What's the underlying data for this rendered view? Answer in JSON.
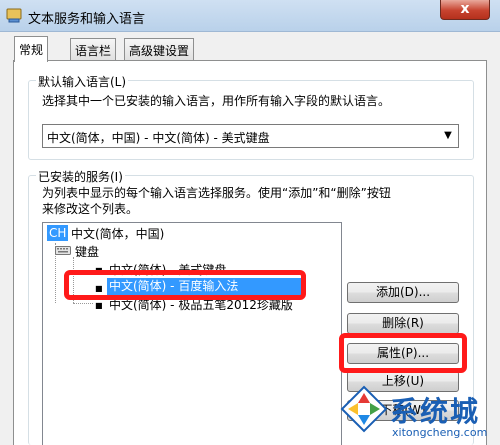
{
  "window": {
    "title": "文本服务和输入语言",
    "close_glyph": "x"
  },
  "tabs": [
    "常规",
    "语言栏",
    "高级键设置"
  ],
  "default_group": {
    "title": "默认输入语言(L)",
    "description": "选择其中一个已安装的输入语言，用作所有输入字段的默认语言。",
    "selected": "中文(简体，中国) - 中文(简体) - 美式键盘"
  },
  "services_group": {
    "title": "已安装的服务(I)",
    "description_line1": "为列表中显示的每个输入语言选择服务。使用“添加”和“删除”按钮",
    "description_line2": "来修改这个列表。"
  },
  "tree": {
    "language_badge": "CH",
    "language": "中文(简体，中国)",
    "keyboard": "键盘",
    "items": [
      "中文(简体) - 美式键盘",
      "中文(简体) - 百度输入法",
      "中文(简体) - 极品五笔2012珍藏版"
    ]
  },
  "buttons": {
    "add": "添加(D)...",
    "remove": "删除(R)",
    "properties": "属性(P)...",
    "move_up": "上移(U)",
    "move_down": "下移(W)"
  },
  "watermark": {
    "name": "系统城",
    "url": "xitongcheng.com"
  },
  "colors": {
    "selection": "#3399ff",
    "highlight": "#ff1a1a",
    "watermark": "#1a5fb4"
  }
}
